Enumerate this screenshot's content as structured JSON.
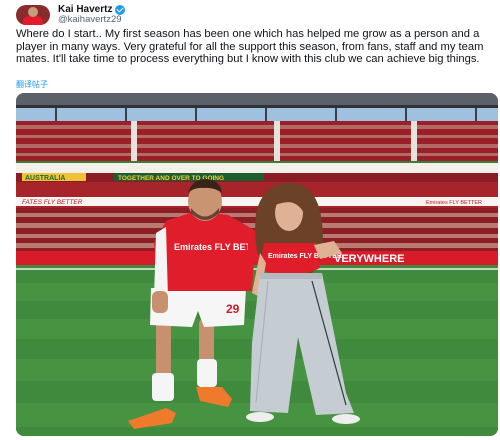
{
  "author": {
    "display_name": "Kai Havertz",
    "handle": "@kaihavertz29",
    "avatar_icon": "avatar-photo",
    "verified_icon": "verified-badge-icon"
  },
  "tweet": {
    "text": "Where do I start.. My first season has been one which has helped me grow as a person and a player in many ways. Very grateful for all the support this season, from fans, staff and my team mates. It'll take time to process everything but I know with this club we can achieve big things.",
    "translate_label": "翻译帖子"
  },
  "photo": {
    "stand_sign_left": "AUSTRALIA",
    "stand_sign_mid": "TOGETHER AND OVER TO GOING",
    "banner_left": "FATES FLY BETTER",
    "banner_right_small": "Emirates FLY BETTER",
    "led_board_text": "VERYWHERE",
    "shirt_sponsor_player": "Emirates FLY BETTER",
    "shirt_sponsor_woman": "Emirates FLY BETTER",
    "shorts_number": "29",
    "colors": {
      "arsenal_red": "#e01e2b",
      "pitch_green": "#3f8a3c",
      "sky": "#9fc0de",
      "link_blue": "#1d9bf0"
    }
  }
}
